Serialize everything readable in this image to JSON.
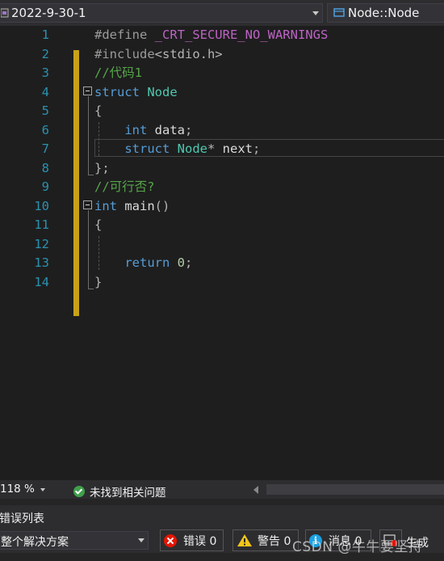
{
  "navbar": {
    "project": "2022-9-30-1",
    "symbol": "Node::Node"
  },
  "editor": {
    "lines": [
      {
        "n": "1",
        "tokens": [
          {
            "t": "#define ",
            "c": "pp"
          },
          {
            "t": "_CRT_SECURE_NO_WARNINGS",
            "c": "mac"
          }
        ]
      },
      {
        "n": "2",
        "tokens": [
          {
            "t": "#include",
            "c": "pp"
          },
          {
            "t": "<stdio.h>",
            "c": "pn"
          }
        ]
      },
      {
        "n": "3",
        "tokens": [
          {
            "t": "//代码1",
            "c": "cm"
          }
        ]
      },
      {
        "n": "4",
        "tokens": [
          {
            "t": "struct",
            "c": "kw"
          },
          {
            "t": " ",
            "c": "id"
          },
          {
            "t": "Node",
            "c": "ty"
          }
        ]
      },
      {
        "n": "5",
        "tokens": [
          {
            "t": "{",
            "c": "pn"
          }
        ]
      },
      {
        "n": "6",
        "tokens": [
          {
            "t": "    ",
            "c": "id"
          },
          {
            "t": "int",
            "c": "kw"
          },
          {
            "t": " data",
            "c": "id"
          },
          {
            "t": ";",
            "c": "pn"
          }
        ]
      },
      {
        "n": "7",
        "tokens": [
          {
            "t": "    ",
            "c": "id"
          },
          {
            "t": "struct",
            "c": "kw"
          },
          {
            "t": " ",
            "c": "id"
          },
          {
            "t": "Node",
            "c": "ty"
          },
          {
            "t": "*",
            "c": "pn"
          },
          {
            "t": " next",
            "c": "id"
          },
          {
            "t": ";",
            "c": "pn"
          }
        ]
      },
      {
        "n": "8",
        "tokens": [
          {
            "t": "};",
            "c": "pn"
          }
        ]
      },
      {
        "n": "9",
        "tokens": [
          {
            "t": "//可行否?",
            "c": "cm"
          }
        ]
      },
      {
        "n": "10",
        "tokens": [
          {
            "t": "int",
            "c": "kw"
          },
          {
            "t": " main",
            "c": "id"
          },
          {
            "t": "()",
            "c": "pn"
          }
        ]
      },
      {
        "n": "11",
        "tokens": [
          {
            "t": "{",
            "c": "pn"
          }
        ]
      },
      {
        "n": "12",
        "tokens": []
      },
      {
        "n": "13",
        "tokens": [
          {
            "t": "    ",
            "c": "id"
          },
          {
            "t": "return",
            "c": "kw"
          },
          {
            "t": " ",
            "c": "id"
          },
          {
            "t": "0",
            "c": "num"
          },
          {
            "t": ";",
            "c": "pn"
          }
        ]
      },
      {
        "n": "14",
        "tokens": [
          {
            "t": "}",
            "c": "pn"
          }
        ]
      }
    ]
  },
  "status": {
    "zoom": "118 %",
    "issues": "未找到相关问题"
  },
  "error_list": {
    "title": "错误列表",
    "scope": "整个解决方案",
    "errors_label": "错误 0",
    "warnings_label": "警告 0",
    "messages_label": "消息 0",
    "build_label": "生成"
  },
  "watermark": "CSDN @牛牛要坚持",
  "colors": {
    "change_bar": "#c7a11a",
    "keyword": "#569cd6",
    "type": "#4ec9b0",
    "comment": "#57a64a",
    "macro": "#bd63c5",
    "line_number": "#2b91af",
    "error": "#e51400",
    "warning": "#f5c518",
    "info": "#1ba1e2",
    "ok": "#3fa04a"
  },
  "icons": [
    "project-icon",
    "class-icon",
    "fold-collapse-icon",
    "check-circle-icon",
    "error-icon",
    "warning-icon",
    "info-icon",
    "build-filter-icon"
  ]
}
